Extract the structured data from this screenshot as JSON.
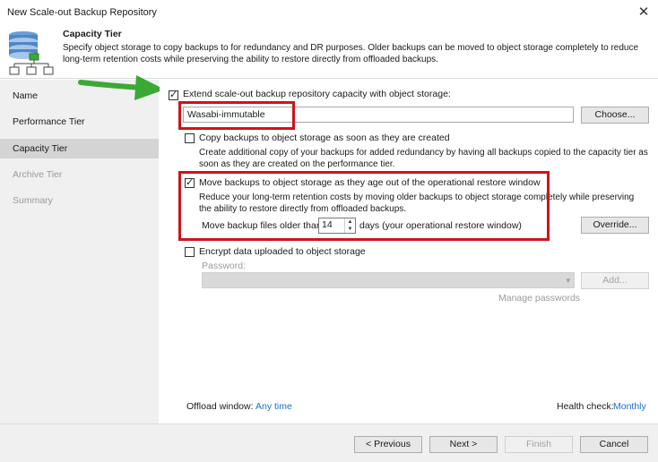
{
  "window": {
    "title": "New Scale-out Backup Repository",
    "close_glyph": "✕"
  },
  "header": {
    "title": "Capacity Tier",
    "description": "Specify object storage to copy backups to for redundancy and DR purposes. Older backups can be moved to object storage completely to reduce long-term retention costs while preserving the ability to restore directly from offloaded backups."
  },
  "sidebar": {
    "items": [
      {
        "label": "Name",
        "state": "normal"
      },
      {
        "label": "Performance Tier",
        "state": "normal"
      },
      {
        "label": "Capacity Tier",
        "state": "active"
      },
      {
        "label": "Archive Tier",
        "state": "disabled"
      },
      {
        "label": "Summary",
        "state": "disabled"
      }
    ]
  },
  "capacity": {
    "extend_label": "Extend scale-out backup repository capacity with object storage:",
    "extend_checked": true,
    "repository_value": "Wasabi-immutable",
    "choose_label": "Choose...",
    "copy_label": "Copy backups to object storage as soon as they are created",
    "copy_checked": false,
    "copy_desc": "Create additional copy of your backups for added redundancy by having all backups copied to the capacity tier as soon as they are created on the performance tier.",
    "move_label": "Move backups to object storage as they age out of the operational restore window",
    "move_checked": true,
    "move_desc": "Reduce your long-term retention costs by moving older backups to object storage completely while preserving the ability to restore directly from offloaded backups.",
    "move_older_prefix": "Move backup files older than",
    "move_days": "14",
    "move_older_suffix": "days (your operational restore window)",
    "override_label": "Override...",
    "encrypt_label": "Encrypt data uploaded to object storage",
    "encrypt_checked": false,
    "password_label": "Password:",
    "add_label": "Add...",
    "manage_passwords": "Manage passwords",
    "offload_label": "Offload window:",
    "offload_value": "Any time",
    "health_label": "Health check:",
    "health_value": "Monthly"
  },
  "footer": {
    "previous": "< Previous",
    "next": "Next >",
    "finish": "Finish",
    "cancel": "Cancel"
  },
  "colors": {
    "highlight_box": "#d0121b",
    "annotation_arrow": "#3aaa35",
    "link": "#1a6fce"
  },
  "icons": {
    "header": "database-tree-icon",
    "annotation": "green-arrow-icon"
  }
}
